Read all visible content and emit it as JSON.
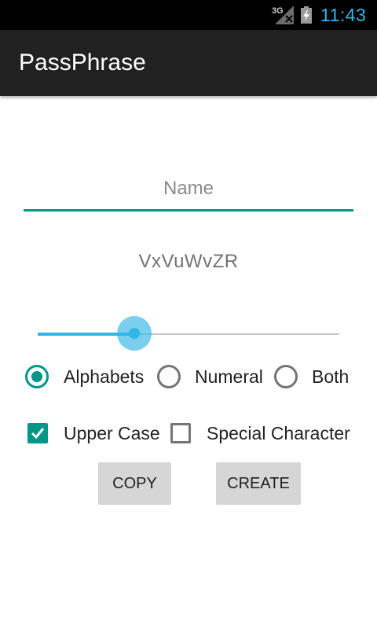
{
  "status_bar": {
    "network_label": "3G",
    "time": "11:43",
    "network_icon": "signal-3g-icon",
    "battery_icon": "battery-charging-icon",
    "clock_color": "#33b5e5"
  },
  "app_bar": {
    "title": "PassPhrase",
    "background": "#212121"
  },
  "name_input": {
    "placeholder": "Name",
    "value": ""
  },
  "generated_passphrase": "VxVuWvZR",
  "length_slider": {
    "fraction": 0.32
  },
  "char_type_options": [
    {
      "label": "Alphabets",
      "selected": true
    },
    {
      "label": "Numeral",
      "selected": false
    },
    {
      "label": "Both",
      "selected": false
    }
  ],
  "checkbox_options": [
    {
      "label": "Upper Case",
      "checked": true
    },
    {
      "label": "Special Character",
      "checked": false
    }
  ],
  "buttons": {
    "copy": "COPY",
    "create": "CREATE"
  },
  "colors": {
    "accent": "#009688",
    "slider": "#33b5e5"
  }
}
